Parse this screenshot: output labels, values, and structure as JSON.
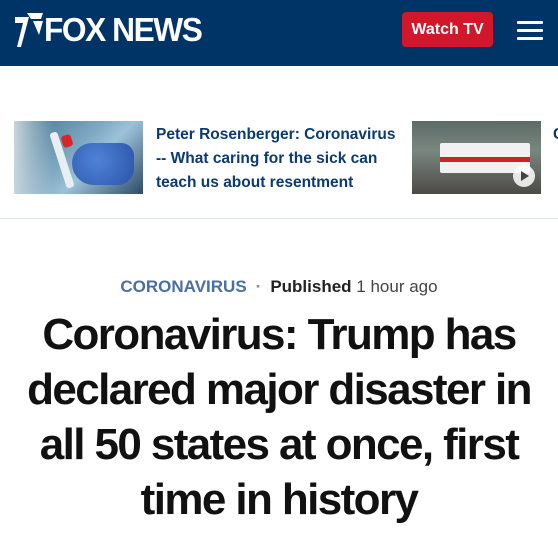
{
  "header": {
    "logo_text": "FOX NEWS",
    "watch_label": "Watch TV",
    "colors": {
      "background": "#003366",
      "watch_button": "#d0182a"
    }
  },
  "trending": {
    "items": [
      {
        "title": "Peter Rosenberger: Coronavirus -- What caring for the sick can teach us about resentment",
        "thumbnail": "gloved-hand-test-tube-image"
      },
      {
        "title": "C",
        "thumbnail": "ambulance-video-image",
        "has_play": true
      }
    ]
  },
  "article": {
    "category": "CORONAVIRUS",
    "separator": "·",
    "published_label": "Published",
    "published_time": "1 hour ago",
    "headline": "Coronavirus: Trump has declared major disaster in all 50 states at once, first time in history"
  }
}
